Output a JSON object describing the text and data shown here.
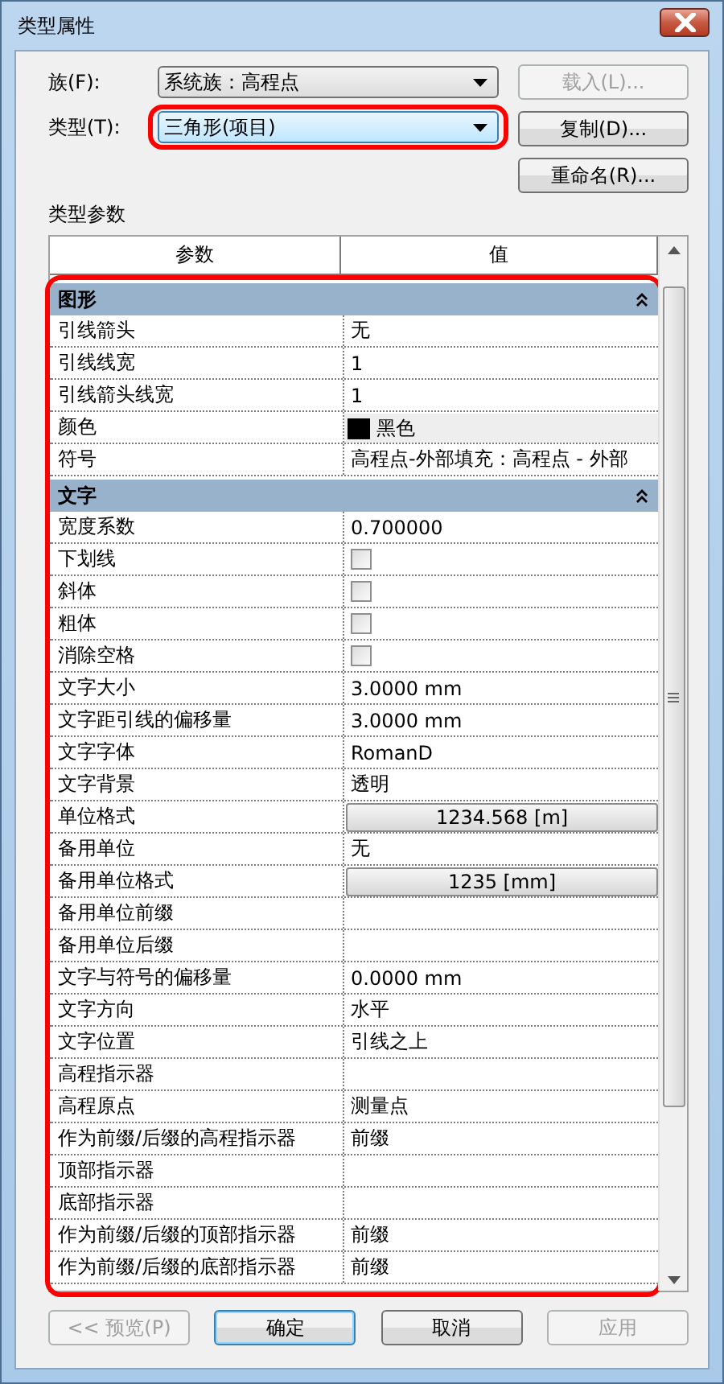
{
  "window": {
    "title": "类型属性"
  },
  "family": {
    "label": "族(F):",
    "value": "系统族：高程点",
    "highlighted": false
  },
  "type": {
    "label": "类型(T):",
    "value": "三角形(项目)",
    "highlighted": true
  },
  "side_buttons": [
    {
      "label": "载入(L)...",
      "disabled": true
    },
    {
      "label": "复制(D)...",
      "disabled": false
    },
    {
      "label": "重命名(R)...",
      "disabled": false
    }
  ],
  "section_label": "类型参数",
  "table": {
    "columns": [
      "参数",
      "值"
    ],
    "highlighted": true,
    "rows": [
      {
        "kind": "group",
        "name": "图形",
        "expanded": true
      },
      {
        "kind": "text",
        "name": "引线箭头",
        "value": "无"
      },
      {
        "kind": "text",
        "name": "引线线宽",
        "value": "1"
      },
      {
        "kind": "text",
        "name": "引线箭头线宽",
        "value": "1"
      },
      {
        "kind": "color",
        "name": "颜色",
        "value": "黑色",
        "color": "#000000"
      },
      {
        "kind": "text",
        "name": "符号",
        "value": "高程点-外部填充：高程点 - 外部"
      },
      {
        "kind": "group",
        "name": "文字",
        "expanded": true
      },
      {
        "kind": "text",
        "name": "宽度系数",
        "value": "0.700000"
      },
      {
        "kind": "checkbox",
        "name": "下划线",
        "checked": false
      },
      {
        "kind": "checkbox",
        "name": "斜体",
        "checked": false
      },
      {
        "kind": "checkbox",
        "name": "粗体",
        "checked": false
      },
      {
        "kind": "checkbox",
        "name": "消除空格",
        "checked": false
      },
      {
        "kind": "text",
        "name": "文字大小",
        "value": "3.0000 mm"
      },
      {
        "kind": "text",
        "name": "文字距引线的偏移量",
        "value": "3.0000 mm"
      },
      {
        "kind": "text",
        "name": "文字字体",
        "value": "RomanD"
      },
      {
        "kind": "text",
        "name": "文字背景",
        "value": "透明"
      },
      {
        "kind": "button",
        "name": "单位格式",
        "value": "1234.568 [m]"
      },
      {
        "kind": "text",
        "name": "备用单位",
        "value": "无"
      },
      {
        "kind": "button",
        "name": "备用单位格式",
        "value": "1235 [mm]"
      },
      {
        "kind": "text",
        "name": "备用单位前缀"
      },
      {
        "kind": "text",
        "name": "备用单位后缀"
      },
      {
        "kind": "text",
        "name": "文字与符号的偏移量",
        "value": "0.0000 mm"
      },
      {
        "kind": "text",
        "name": "文字方向",
        "value": "水平"
      },
      {
        "kind": "text",
        "name": "文字位置",
        "value": "引线之上"
      },
      {
        "kind": "text",
        "name": "高程指示器"
      },
      {
        "kind": "text",
        "name": "高程原点",
        "value": "测量点"
      },
      {
        "kind": "text",
        "name": "作为前缀/后缀的高程指示器",
        "value": "前缀"
      },
      {
        "kind": "text",
        "name": "顶部指示器"
      },
      {
        "kind": "text",
        "name": "底部指示器"
      },
      {
        "kind": "text",
        "name": "作为前缀/后缀的顶部指示器",
        "value": "前缀"
      },
      {
        "kind": "text",
        "name": "作为前缀/后缀的底部指示器",
        "value": "前缀"
      }
    ]
  },
  "buttons": [
    {
      "label": "<< 预览(P)",
      "disabled": true,
      "default": false
    },
    {
      "label": "确定",
      "disabled": false,
      "default": true
    },
    {
      "label": "取消",
      "disabled": false,
      "default": false
    },
    {
      "label": "应用",
      "disabled": true,
      "default": false
    }
  ]
}
